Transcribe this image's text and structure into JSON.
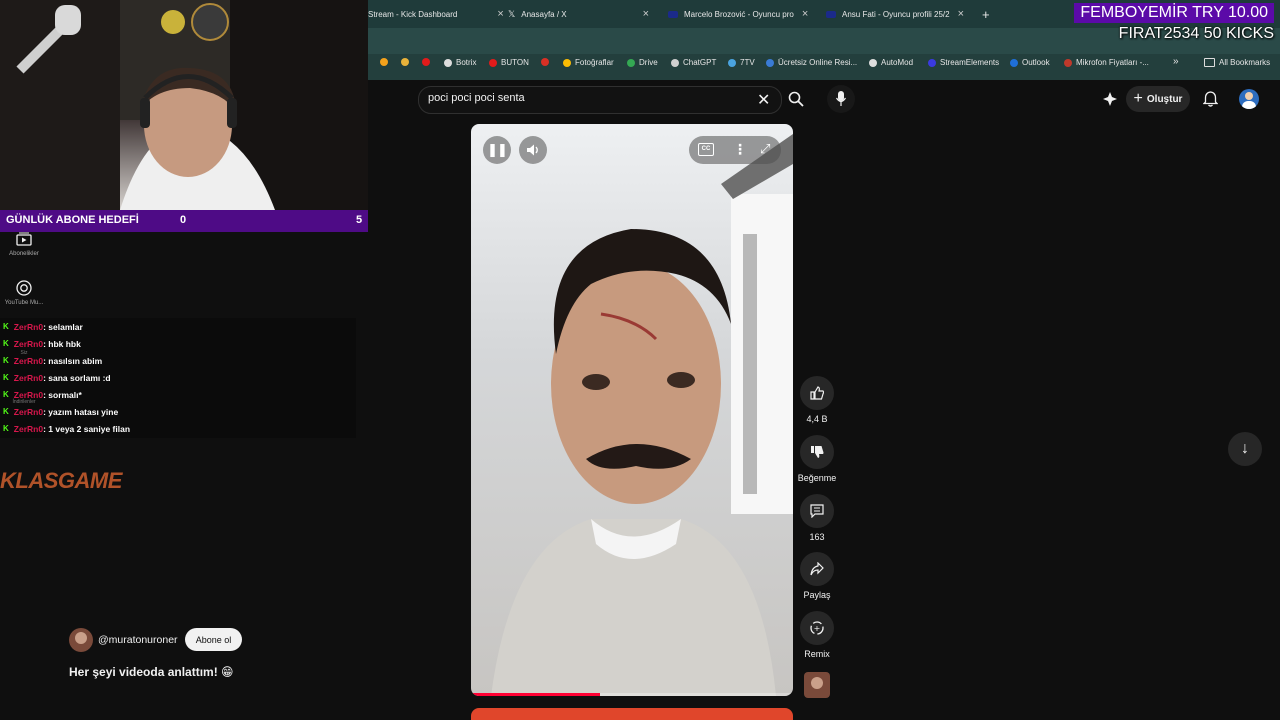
{
  "browser": {
    "tabs": [
      {
        "label": "Stream - Kick Dashboard"
      },
      {
        "label": "Anasayfa / X"
      },
      {
        "label": "Marcelo Brozović - Oyuncu pro"
      },
      {
        "label": "Ansu Fati - Oyuncu profili 25/2"
      }
    ],
    "new_tab": "+",
    "bookmarks": [
      "Botrix",
      "BUTON",
      "Fotoğraflar",
      "Drive",
      "ChatGPT",
      "7TV",
      "Ücretsiz Online Resi...",
      "AutoMod",
      "StreamElements",
      "Outlook",
      "Mikrofon Fiyatları -..."
    ],
    "bookmarks_more": "»",
    "all_bookmarks": "All Bookmarks"
  },
  "alert": {
    "line1": "FEMBOYEMİR  TRY 10.00",
    "line2": "FIRAT2534  50 KICKS"
  },
  "stream_overlay": {
    "goal_label": "GÜNLÜK ABONE HEDEFİ",
    "goal_current": "0",
    "goal_target": "5",
    "sponsor": "KLASGAME"
  },
  "chat": [
    {
      "user": "ZerRn0",
      "message": ": selamlar"
    },
    {
      "user": "ZerRn0",
      "message": ": hbk hbk"
    },
    {
      "user": "ZerRn0",
      "message": ": nasılsın abim"
    },
    {
      "user": "ZerRn0",
      "message": ": sana sorlamı :d"
    },
    {
      "user": "ZerRn0",
      "message": ": sormalı*"
    },
    {
      "user": "ZerRn0",
      "message": ": yazım hatası yine"
    },
    {
      "user": "ZerRn0",
      "message": ": 1 veya 2 saniye filan"
    }
  ],
  "youtube": {
    "search_value": "poci poci poci senta",
    "create_label": "Oluştur",
    "sidebar": [
      {
        "label": "Abonelikler",
        "icon": "subscriptions-icon"
      },
      {
        "label": "YouTube Mu...",
        "icon": "youtube-music-icon"
      },
      {
        "label": "Siz",
        "icon": "you-icon"
      },
      {
        "label": "İndirilenler",
        "icon": "download-icon"
      }
    ],
    "short": {
      "channel": "@muratonuroner",
      "subscribe_label": "Abone ol",
      "title": "Her şeyi videoda anlattım! 😁",
      "progress": 0.4
    },
    "actions": {
      "like_count": "4,4 B",
      "dislike_label": "Beğenme",
      "comment_count": "163",
      "share_label": "Paylaş",
      "remix_label": "Remix"
    }
  },
  "colors": {
    "kick_green": "#53fc18",
    "overlay_purple": "#4e0b86",
    "chat_user": "#d8174c",
    "yt_red": "#ff0033"
  }
}
